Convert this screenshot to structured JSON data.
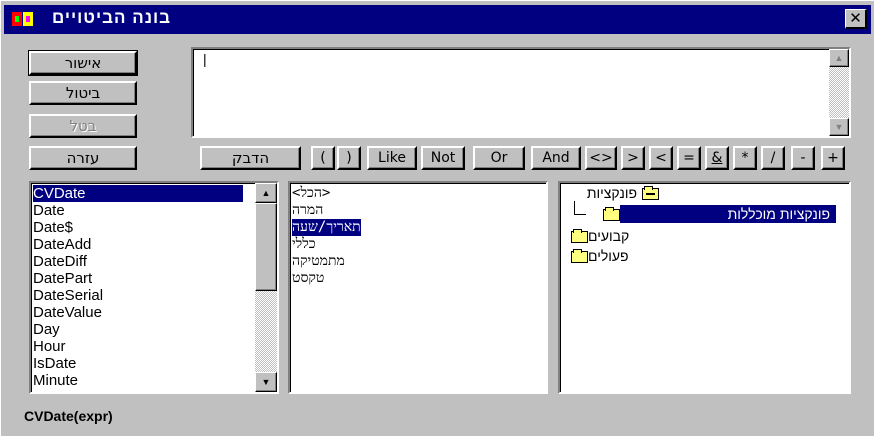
{
  "window": {
    "title": "בונה הביטויים",
    "close_glyph": "✕",
    "icon": "expression-builder-icon"
  },
  "buttons": {
    "ok": "אישור",
    "cancel": "ביטול",
    "undo": "בטל",
    "help": "עזרה",
    "paste": "הדבק"
  },
  "operators": [
    "(",
    ")",
    "Like",
    "Not",
    "Or",
    "And",
    "<>",
    ">",
    "<",
    "=",
    "&",
    "*",
    "/",
    "-",
    "+"
  ],
  "expression_box": {
    "value": "",
    "cursor": "|"
  },
  "functions_list": {
    "items": [
      "CVDate",
      "Date",
      "Date$",
      "DateAdd",
      "DateDiff",
      "DatePart",
      "DateSerial",
      "DateValue",
      "Day",
      "Hour",
      "IsDate",
      "Minute"
    ],
    "selected_index": 0
  },
  "categories_list": {
    "items": [
      "<הכל>",
      "המרה",
      "תאריך/שעה",
      "כללי",
      "מתמטיקה",
      "טקסט"
    ],
    "selected_index": 2
  },
  "tree": {
    "root": "פונקציות",
    "child": "פונקציות מוכללות",
    "nodes": [
      "קבועים",
      "פעולים"
    ]
  },
  "status": {
    "syntax": "CVDate(expr)"
  }
}
